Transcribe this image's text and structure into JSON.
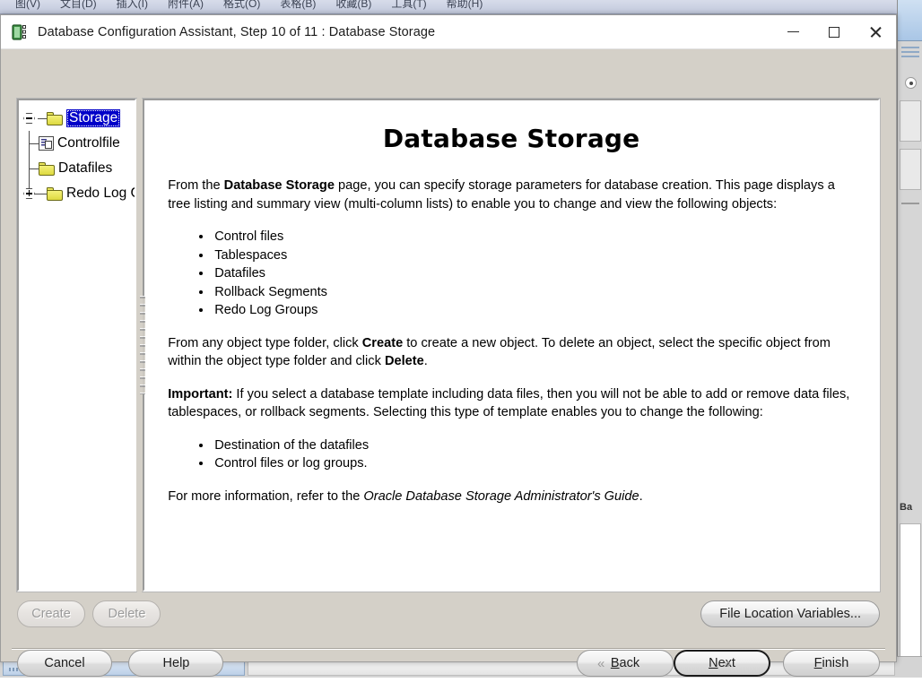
{
  "background": {
    "menubar": [
      "图(V)",
      "文目(D)",
      "插入(I)",
      "附件(A)",
      "格式(O)",
      "表格(B)",
      "收藏(B)",
      "工具(T)",
      "帮助(H)"
    ],
    "right_window_text": "Ba"
  },
  "window": {
    "title": "Database Configuration Assistant, Step 10 of 11 : Database Storage",
    "icon": "database-icon",
    "controls": {
      "minimize": "minimize-icon",
      "maximize": "maximize-icon",
      "close": "close-icon"
    }
  },
  "tree": {
    "root": {
      "label": "Storage",
      "selected": true,
      "expanded": true,
      "icon": "folder-icon"
    },
    "children": [
      {
        "label": "Controlfile",
        "icon": "controlfile-icon",
        "expandable": false
      },
      {
        "label": "Datafiles",
        "icon": "folder-icon",
        "expandable": false
      },
      {
        "label": "Redo Log Groups",
        "icon": "folder-icon",
        "expandable": true
      }
    ]
  },
  "content": {
    "heading": "Database Storage",
    "intro": {
      "lead": "From the ",
      "bold1": "Database Storage",
      "rest": " page, you can specify storage parameters for database creation. This page displays a tree listing and summary view (multi-column lists) to enable you to change and view the following objects:"
    },
    "objects_list": [
      "Control files",
      "Tablespaces",
      "Datafiles",
      "Rollback Segments",
      "Redo Log Groups"
    ],
    "create_delete_para": {
      "p1": "From any object type folder, click ",
      "bold1": "Create",
      "p2": " to create a new object. To delete an object, select the specific object from within the object type folder and click ",
      "bold2": "Delete",
      "p3": "."
    },
    "important_para": {
      "bold1": "Important:",
      "text": " If you select a database template including data files, then you will not be able to add or remove data files, tablespaces, or rollback segments. Selecting this type of template enables you to change the following:"
    },
    "change_list": [
      "Destination of the datafiles",
      "Control files or log groups."
    ],
    "footer_para": {
      "lead": "For more information, refer to the ",
      "italic": "Oracle Database Storage Administrator's Guide",
      "tail": "."
    }
  },
  "buttons": {
    "create": {
      "label": "Create",
      "disabled": true
    },
    "delete": {
      "label": "Delete",
      "disabled": true
    },
    "file_location_variables": {
      "label": "File Location Variables...",
      "disabled": false
    },
    "cancel": {
      "label": "Cancel",
      "disabled": false
    },
    "help": {
      "label": "Help",
      "disabled": false
    },
    "back": {
      "label": "Back",
      "mnemonic": "B",
      "arrow": "«",
      "disabled": false
    },
    "next": {
      "label": "Next",
      "mnemonic": "N",
      "arrow": "»",
      "default": true,
      "disabled": false
    },
    "finish": {
      "label": "Finish",
      "mnemonic": "F",
      "disabled": false
    }
  }
}
